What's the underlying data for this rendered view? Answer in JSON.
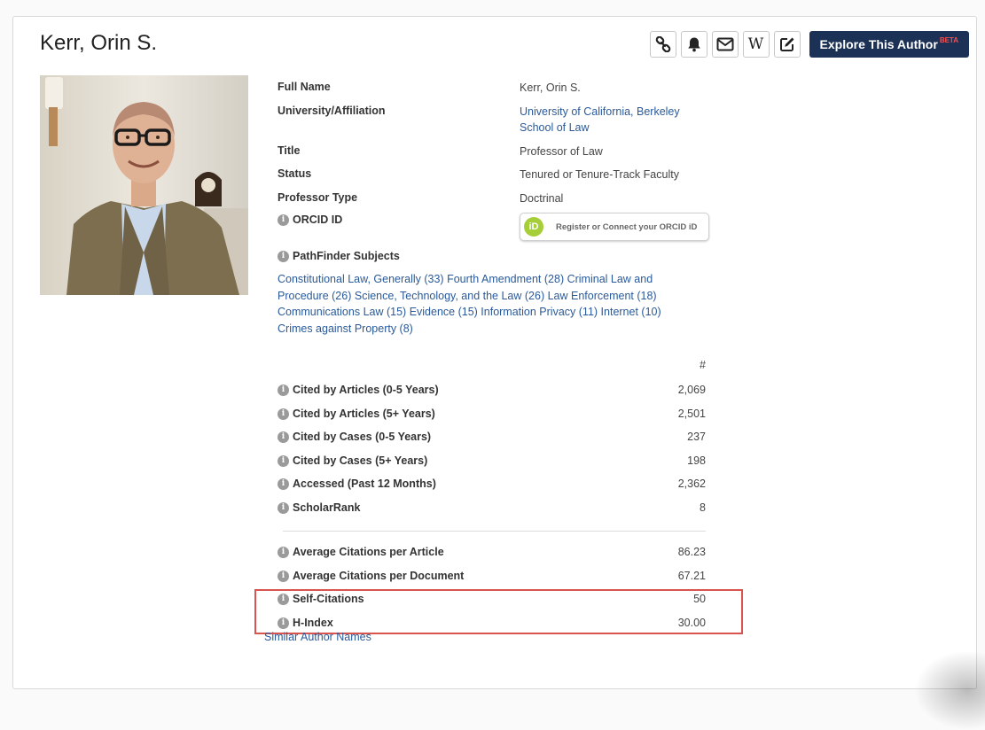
{
  "author": {
    "name": "Kerr, Orin S."
  },
  "toolbar": {
    "icons": [
      "link-icon",
      "bell-icon",
      "envelope-icon",
      "wikipedia-icon",
      "edit-icon"
    ],
    "wikipedia_glyph": "W",
    "explore_label": "Explore This Author",
    "explore_badge": "BETA"
  },
  "details": {
    "full_name_label": "Full Name",
    "full_name_value": "Kerr, Orin S.",
    "affiliation_label": "University/Affiliation",
    "affiliation_line1": "University of California, Berkeley",
    "affiliation_line2": "School of Law",
    "title_label": "Title",
    "title_value": "Professor of Law",
    "status_label": "Status",
    "status_value": "Tenured or Tenure-Track Faculty",
    "type_label": "Professor Type",
    "type_value": "Doctrinal",
    "orcid_label": "ORCID ID",
    "orcid_logo": "iD",
    "orcid_button": "Register or Connect your ORCID iD",
    "pathfinder_label": "PathFinder Subjects"
  },
  "subjects": [
    "Constitutional Law, Generally (33)",
    "Fourth Amendment (28)",
    "Criminal Law and Procedure (26)",
    "Science, Technology, and the Law (26)",
    "Law Enforcement (18)",
    "Communications Law (15)",
    "Evidence (15)",
    "Information Privacy (11)",
    "Internet (10)",
    "Crimes against Property (8)"
  ],
  "metrics": {
    "column_header": "#",
    "rows": [
      {
        "label": "Cited by Articles (0-5 Years)",
        "value": "2,069"
      },
      {
        "label": "Cited by Articles (5+ Years)",
        "value": "2,501"
      },
      {
        "label": "Cited by Cases (0-5 Years)",
        "value": "237"
      },
      {
        "label": "Cited by Cases (5+ Years)",
        "value": "198"
      },
      {
        "label": "Accessed (Past 12 Months)",
        "value": "2,362"
      },
      {
        "label": "ScholarRank",
        "value": "8"
      }
    ],
    "rows2": [
      {
        "label": "Average Citations per Article",
        "value": "86.23"
      },
      {
        "label": "Average Citations per Document",
        "value": "67.21"
      },
      {
        "label": "Self-Citations",
        "value": "50"
      },
      {
        "label": "H-Index",
        "value": "30.00"
      }
    ]
  },
  "similar_link": "Similar Author Names",
  "colors": {
    "brand_navy": "#1b3156",
    "link": "#2a5a9a",
    "highlight": "#d9534f",
    "orcid_green": "#a6ce39"
  }
}
